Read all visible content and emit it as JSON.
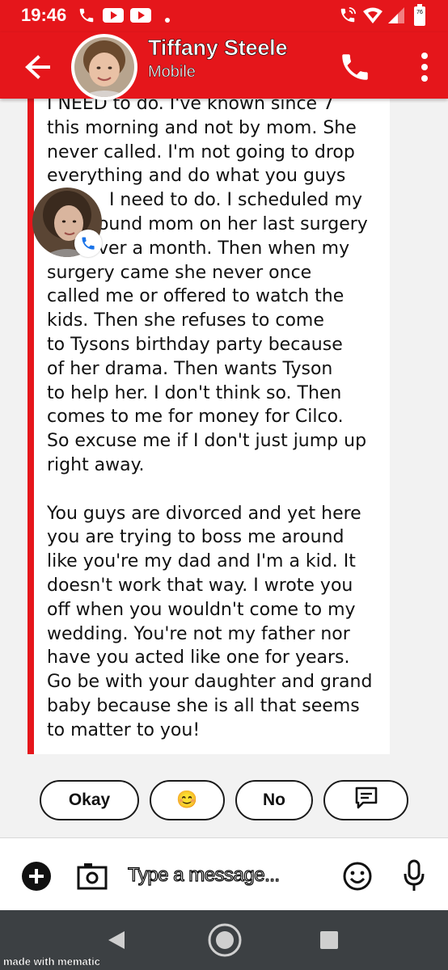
{
  "status_bar": {
    "time": "19:46",
    "battery_level": "76",
    "icons": [
      "phone-icon",
      "youtube-icon",
      "youtube-icon",
      "dot-icon",
      "wifi-calling-icon",
      "wifi-icon",
      "signal-icon",
      "battery-icon"
    ]
  },
  "header": {
    "contact_name": "Tiffany Steele",
    "contact_subtitle": "Mobile",
    "icons": [
      "back-arrow-icon",
      "contact-avatar",
      "phone-call-icon",
      "more-vert-icon"
    ]
  },
  "conversation": {
    "message_text": "I NEED to do. I've known since 7\nthis morning and not by mom. She\nnever called. I'm not going to drop\neverything and do what you guys\n           I need to do. I scheduled my\n         ound mom on her last surgery\n         ver a month. Then when my\nsurgery came she never once\ncalled me or offered to watch the\nkids. Then she refuses to come\nto Tysons birthday party because\nof her drama. Then wants Tyson\nto help her. I don't think so. Then\ncomes to me for money for Cilco.\nSo excuse me if I don't just jump up\nright away.\n\nYou guys are divorced and yet here\nyou are trying to boss me around\nlike you're my dad and I'm a kid. It\ndoesn't work that way. I wrote you\noff when you wouldn't come to my\nwedding. You're not my father nor\nhave you acted like one for years.\nGo be with your daughter and grand\nbaby because she is all that seems\nto matter to you!"
  },
  "quick_replies": [
    {
      "label": "Okay"
    },
    {
      "label": "😊"
    },
    {
      "label": "No"
    },
    {
      "icon": "message-template-icon"
    }
  ],
  "composer": {
    "placeholder": "Type a message...",
    "icons": [
      "add-circle-icon",
      "camera-icon",
      "emoji-icon",
      "microphone-icon"
    ]
  },
  "nav_bar": {
    "icons": [
      "back-triangle-icon",
      "home-circle-icon",
      "recents-square-icon"
    ]
  },
  "watermark": "made with mematic",
  "colors": {
    "brand_red": "#e5161b",
    "nav_bar": "#3c4043",
    "badge_blue": "#1a73e8"
  }
}
